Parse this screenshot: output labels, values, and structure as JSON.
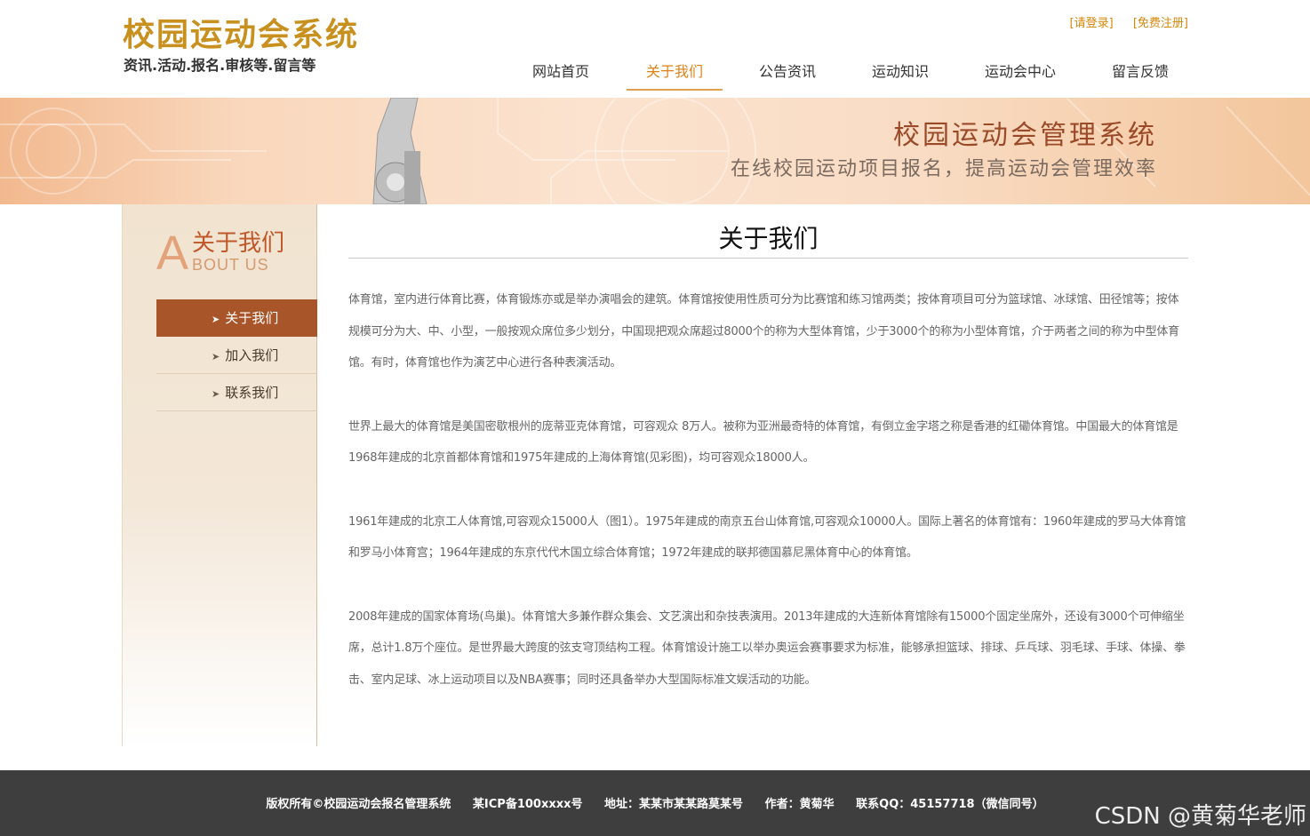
{
  "header": {
    "logo_title": "校园运动会系统",
    "logo_subtitle": "资讯.活动.报名.审核等.留言等",
    "login_link": "[请登录]",
    "register_link": "[免费注册]",
    "nav": [
      {
        "label": "网站首页"
      },
      {
        "label": "关于我们"
      },
      {
        "label": "公告资讯"
      },
      {
        "label": "运动知识"
      },
      {
        "label": "运动会中心"
      },
      {
        "label": "留言反馈"
      }
    ],
    "active_nav": "关于我们"
  },
  "banner": {
    "title": "校园运动会管理系统",
    "subtitle": "在线校园运动项目报名，提高运动会管理效率"
  },
  "sidebar": {
    "heading_letter": "A",
    "heading_cn": "关于我们",
    "heading_en": "BOUT US",
    "items": [
      {
        "label": "关于我们"
      },
      {
        "label": "加入我们"
      },
      {
        "label": "联系我们"
      }
    ],
    "active_item": "关于我们"
  },
  "main": {
    "title": "关于我们",
    "paragraphs": [
      "体育馆，室内进行体育比赛，体育锻炼亦或是举办演唱会的建筑。体育馆按使用性质可分为比赛馆和练习馆两类；按体育项目可分为篮球馆、冰球馆、田径馆等；按体规模可分为大、中、小型，一般按观众席位多少划分，中国现把观众席超过8000个的称为大型体育馆，少于3000个的称为小型体育馆，介于两者之间的称为中型体育馆。有时，体育馆也作为演艺中心进行各种表演活动。",
      "世界上最大的体育馆是美国密歇根州的庞蒂亚克体育馆，可容观众 8万人。被称为亚洲最奇特的体育馆，有倒立金字塔之称是香港的红磡体育馆。中国最大的体育馆是1968年建成的北京首都体育馆和1975年建成的上海体育馆(见彩图)，均可容观众18000人。",
      "1961年建成的北京工人体育馆,可容观众15000人（图1）。1975年建成的南京五台山体育馆,可容观众10000人。国际上著名的体育馆有：1960年建成的罗马大体育馆和罗马小体育宫；1964年建成的东京代代木国立综合体育馆；1972年建成的联邦德国慕尼黑体育中心的体育馆。",
      "2008年建成的国家体育场(鸟巢)。体育馆大多兼作群众集会、文艺演出和杂技表演用。2013年建成的大连新体育馆除有15000个固定坐席外，还设有3000个可伸缩坐席，总计1.8万个座位。是世界最大跨度的弦支穹顶结构工程。体育馆设计施工以举办奥运会赛事要求为标准，能够承担篮球、排球、乒乓球、羽毛球、手球、体操、拳击、室内足球、冰上运动项目以及NBA赛事；同时还具备举办大型国际标准文娱活动的功能。"
    ]
  },
  "footer": {
    "copyright": "版权所有©校园运动会报名管理系统",
    "icp": "某ICP备100xxxx号",
    "address": "地址：某某市某某路莫某号",
    "author": "作者：黄菊华",
    "contact": "联系QQ：45157718（微信同号）"
  },
  "watermark": "CSDN @黄菊华老师",
  "colors": {
    "brand_gold": "#c8911f",
    "nav_active": "#e0821a",
    "sidebar_active_bg": "#a8552a",
    "footer_bg": "#3e3e3e",
    "banner_title": "#9a4a28"
  }
}
